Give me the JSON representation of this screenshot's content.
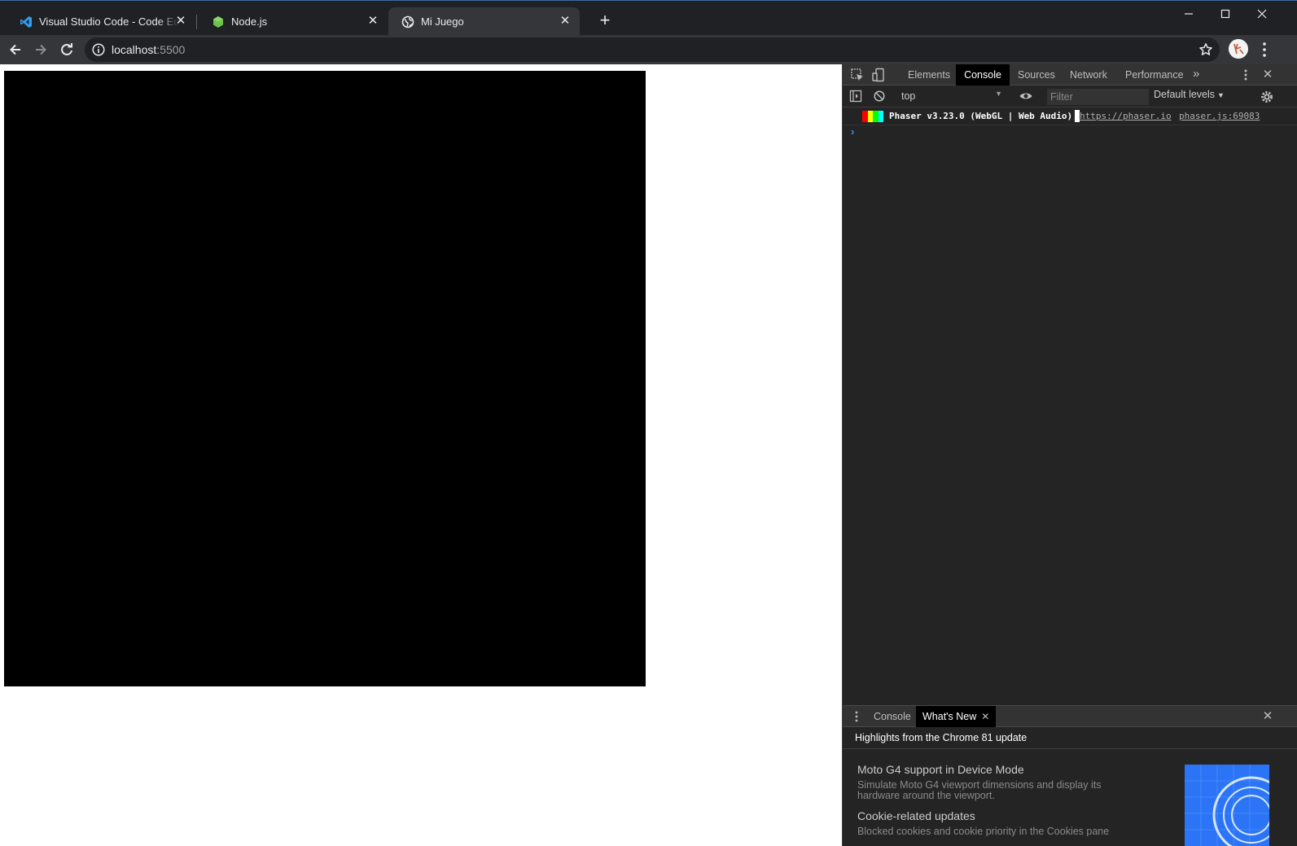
{
  "browser": {
    "tabs": [
      {
        "title": "Visual Studio Code - Code Editing",
        "icon": "vscode-icon",
        "active": false
      },
      {
        "title": "Node.js",
        "icon": "nodejs-icon",
        "active": false
      },
      {
        "title": "Mi Juego",
        "icon": "globe-icon",
        "active": true
      }
    ],
    "new_tab": "+",
    "window_controls": [
      "minimize-icon",
      "maximize-icon",
      "close-icon"
    ],
    "address": {
      "host": "localhost",
      "port": ":5500"
    },
    "colors": {
      "tabstrip": "#202124",
      "toolbar": "#35363a",
      "omnibox": "#202124"
    }
  },
  "page": {
    "canvas_color": "#000000",
    "background": "#ffffff"
  },
  "devtools": {
    "tabs": [
      "Elements",
      "Console",
      "Sources",
      "Network",
      "Performance"
    ],
    "active_tab": "Console",
    "more_tabs": "»",
    "console": {
      "context": "top",
      "filter_placeholder": "Filter",
      "levels": "Default levels",
      "messages": [
        {
          "text": "Phaser v3.23.0 (WebGL | Web Audio)",
          "link": "https://phaser.io",
          "source": "phaser.js:69083",
          "badge_colors": [
            "#ff0000",
            "#ffff00",
            "#00ff00",
            "#00ffff"
          ]
        }
      ],
      "prompt": "›"
    },
    "drawer": {
      "tabs": [
        "Console",
        "What's New"
      ],
      "active_tab": "What's New",
      "header": "Highlights from the Chrome 81 update",
      "items": [
        {
          "title": "Moto G4 support in Device Mode",
          "description": "Simulate Moto G4 viewport dimensions and display its hardware around the viewport."
        },
        {
          "title": "Cookie-related updates",
          "description": "Blocked cookies and cookie priority in the Cookies pane"
        }
      ]
    }
  }
}
